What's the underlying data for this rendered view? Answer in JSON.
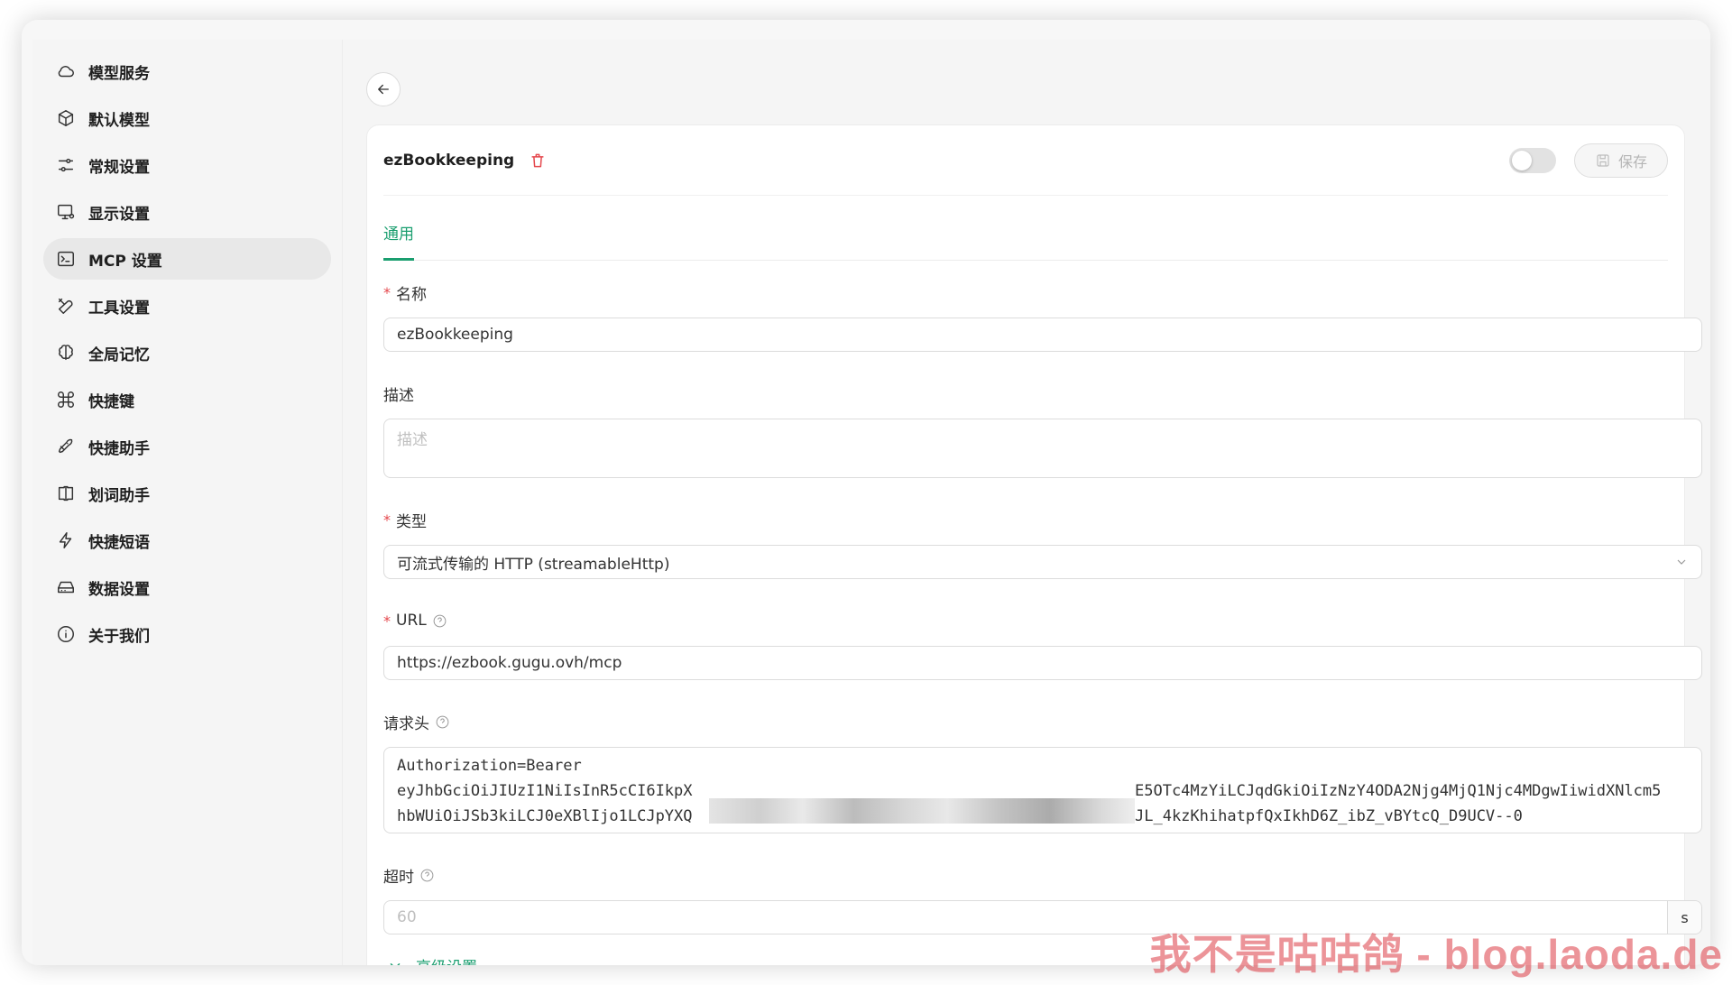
{
  "sidebar": {
    "items": [
      {
        "label": "模型服务",
        "icon": "cloud-icon",
        "active": false
      },
      {
        "label": "默认模型",
        "icon": "cube-icon",
        "active": false
      },
      {
        "label": "常规设置",
        "icon": "sliders-icon",
        "active": false
      },
      {
        "label": "显示设置",
        "icon": "monitor-settings-icon",
        "active": false
      },
      {
        "label": "MCP 设置",
        "icon": "terminal-icon",
        "active": true
      },
      {
        "label": "工具设置",
        "icon": "tools-icon",
        "active": false
      },
      {
        "label": "全局记忆",
        "icon": "brain-icon",
        "active": false
      },
      {
        "label": "快捷键",
        "icon": "command-icon",
        "active": false
      },
      {
        "label": "快捷助手",
        "icon": "rocket-icon",
        "active": false
      },
      {
        "label": "划词助手",
        "icon": "text-cursor-icon",
        "active": false
      },
      {
        "label": "快捷短语",
        "icon": "zap-icon",
        "active": false
      },
      {
        "label": "数据设置",
        "icon": "hard-drive-icon",
        "active": false
      },
      {
        "label": "关于我们",
        "icon": "info-icon",
        "active": false
      }
    ]
  },
  "header": {
    "server_name": "ezBookkeeping",
    "save_label": "保存",
    "enabled": false
  },
  "tabs": [
    {
      "label": "通用",
      "active": true
    }
  ],
  "form": {
    "name": {
      "label": "名称",
      "required": true,
      "value": "ezBookkeeping"
    },
    "description": {
      "label": "描述",
      "required": false,
      "placeholder": "描述"
    },
    "type": {
      "label": "类型",
      "required": true,
      "value": "可流式传输的 HTTP (streamableHttp)"
    },
    "url": {
      "label": "URL",
      "required": true,
      "value": "https://ezbook.gugu.ovh/mcp"
    },
    "headers": {
      "label": "请求头",
      "line1": "Authorization=Bearer",
      "line2_start": "eyJhbGciOiJIUzI1NiIsInR5cCI6IkpX",
      "line2_end": "E5OTc4MzYiLCJqdGkiOiIzNzY4ODA2Njg4MjQ1Njc4MDgwIiwidXNlcm5",
      "line3_start": "hbWUiOiJSb3kiLCJ0eXBlIjo1LCJpYXQ",
      "line3_end": "JL_4kzKhihatpfQxIkhD6Z_ibZ_vBYtcQ_D9UCV--0"
    },
    "timeout": {
      "label": "超时",
      "placeholder": "60",
      "unit": "s"
    },
    "advanced_label": "高级设置"
  },
  "watermark": "我不是咕咕鸽 - blog.laoda.de",
  "colors": {
    "accent": "#1a9e6f",
    "danger": "#e5484d"
  }
}
